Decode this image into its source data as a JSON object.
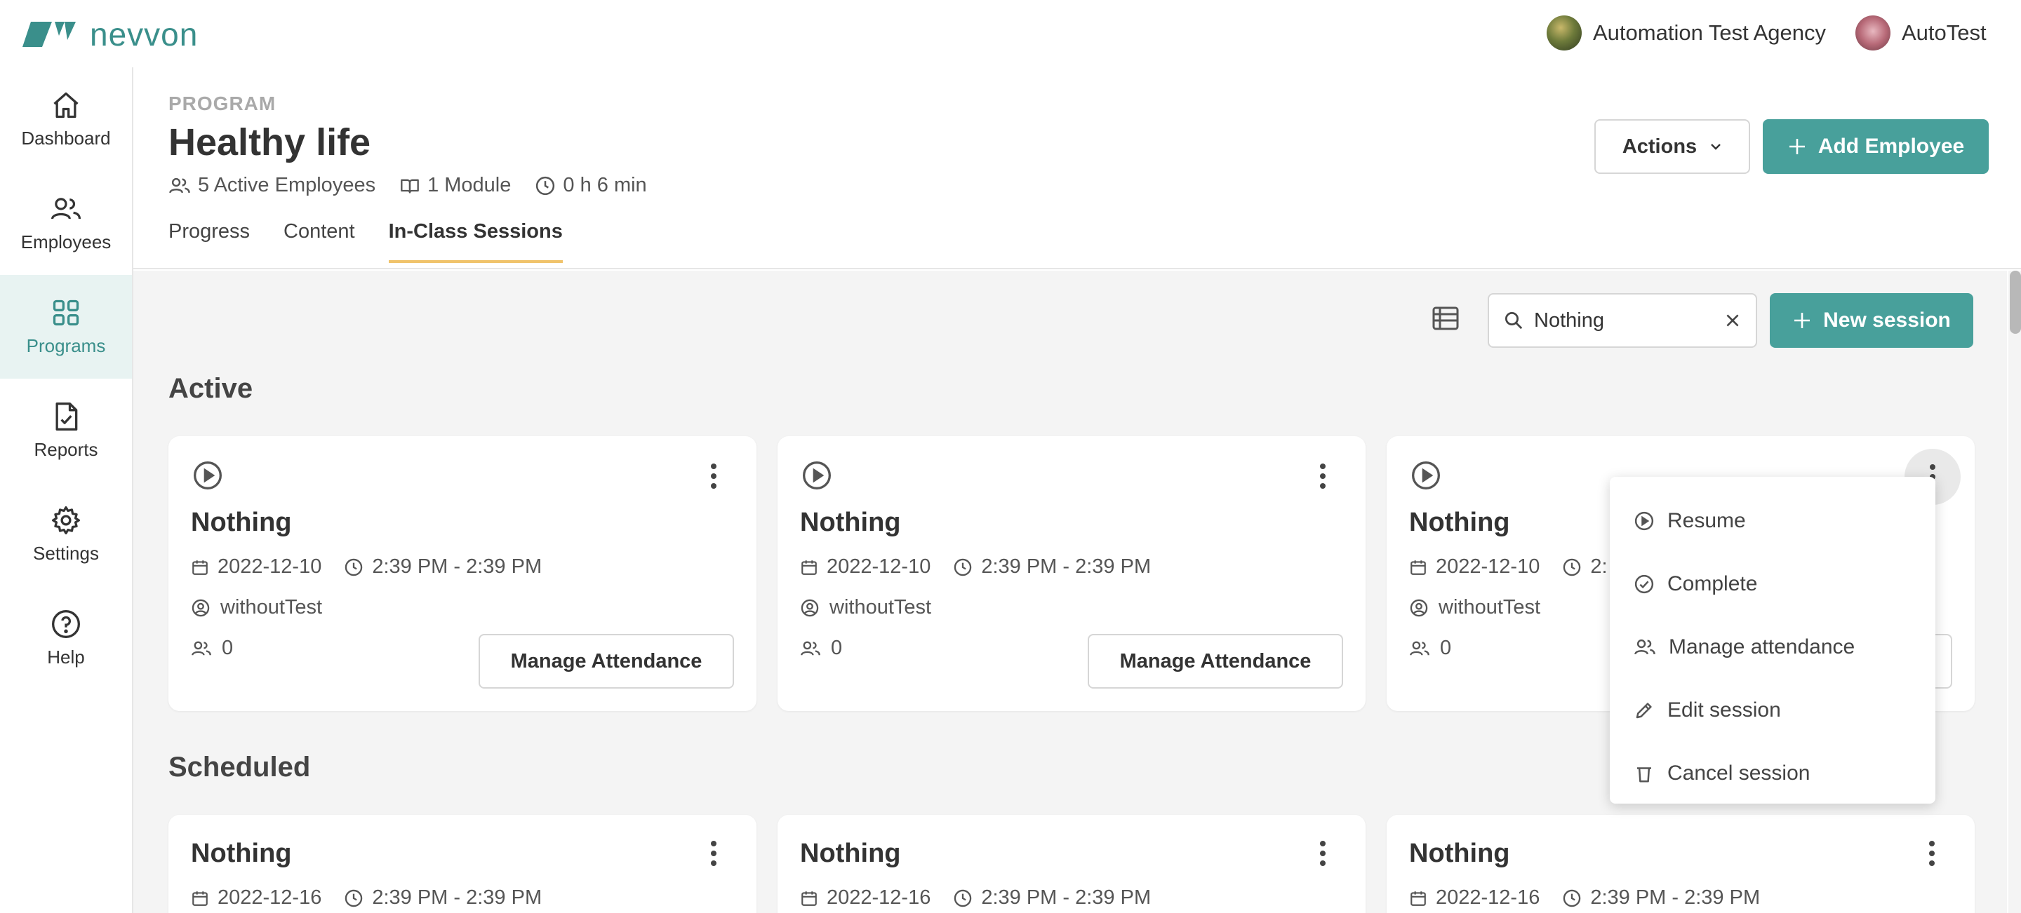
{
  "brand": {
    "name": "nevvon",
    "color": "#3a8f8b"
  },
  "account": {
    "agency": "Automation Test Agency",
    "user": "AutoTest"
  },
  "sidebar": {
    "items": [
      {
        "label": "Dashboard",
        "icon": "home-icon"
      },
      {
        "label": "Employees",
        "icon": "users-icon"
      },
      {
        "label": "Programs",
        "icon": "grid-icon",
        "active": true
      },
      {
        "label": "Reports",
        "icon": "report-icon"
      },
      {
        "label": "Settings",
        "icon": "gear-icon"
      },
      {
        "label": "Help",
        "icon": "help-icon"
      }
    ]
  },
  "header": {
    "eyebrow": "PROGRAM",
    "title": "Healthy life",
    "meta": {
      "employees": "5 Active Employees",
      "modules": "1 Module",
      "duration": "0 h 6 min"
    },
    "tabs": [
      "Progress",
      "Content",
      "In-Class Sessions"
    ],
    "active_tab": "In-Class Sessions",
    "actions_label": "Actions",
    "add_employee_label": "Add Employee"
  },
  "toolbar": {
    "search_value": "Nothing",
    "new_session_label": "New session"
  },
  "sections": {
    "active_title": "Active",
    "scheduled_title": "Scheduled"
  },
  "active_sessions": [
    {
      "name": "Nothing",
      "date": "2022-12-10",
      "time": "2:39 PM - 2:39 PM",
      "instructor": "withoutTest",
      "attendees": "0",
      "button": "Manage Attendance"
    },
    {
      "name": "Nothing",
      "date": "2022-12-10",
      "time": "2:39 PM - 2:39 PM",
      "instructor": "withoutTest",
      "attendees": "0",
      "button": "Manage Attendance"
    },
    {
      "name": "Nothing",
      "date": "2022-12-10",
      "time_partial": "2:",
      "instructor": "withoutTest",
      "attendees": "0"
    }
  ],
  "scheduled_sessions": [
    {
      "name": "Nothing",
      "date": "2022-12-16",
      "time": "2:39 PM - 2:39 PM"
    },
    {
      "name": "Nothing",
      "date": "2022-12-16",
      "time": "2:39 PM - 2:39 PM"
    },
    {
      "name": "Nothing",
      "date": "2022-12-16",
      "time": "2:39 PM - 2:39 PM"
    }
  ],
  "session_menu": {
    "items": [
      {
        "label": "Resume",
        "icon": "play-circle-icon"
      },
      {
        "label": "Complete",
        "icon": "check-circle-icon"
      },
      {
        "label": "Manage attendance",
        "icon": "users-icon"
      },
      {
        "label": "Edit session",
        "icon": "pencil-icon"
      },
      {
        "label": "Cancel session",
        "icon": "trash-icon"
      }
    ]
  },
  "colors": {
    "accent": "#48a09b",
    "tab_underline": "#f0c36b",
    "background": "#f4f4f4"
  }
}
